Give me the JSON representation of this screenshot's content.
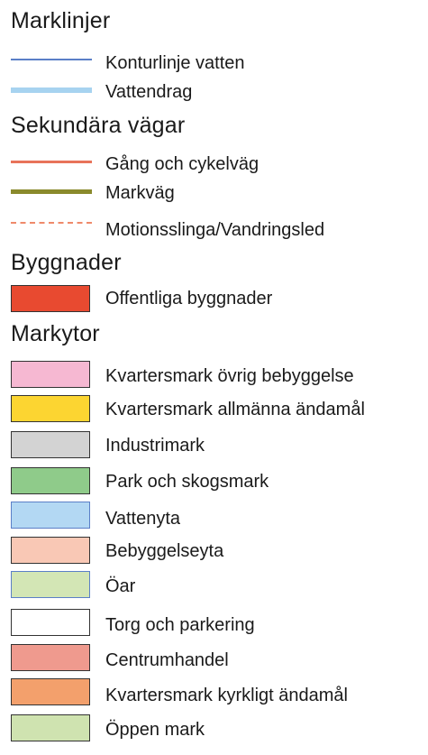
{
  "legend": {
    "marklinjer": {
      "heading": "Marklinjer",
      "items": [
        {
          "label": "Konturlinje vatten",
          "color": "#5b7fc7",
          "style": "line-thin"
        },
        {
          "label": "Vattendrag",
          "color": "#a7d3f0",
          "style": "line-thick"
        }
      ]
    },
    "sekundara_vagar": {
      "heading": "Sekundära vägar",
      "items": [
        {
          "label": "Gång och cykelväg",
          "color": "#e8735a",
          "style": "line"
        },
        {
          "label": "Markväg",
          "color": "#8a8a2c",
          "style": "line-thick"
        },
        {
          "label": "Motionsslinga/Vandringsled",
          "color": "#ef8a6a",
          "style": "dashed"
        }
      ]
    },
    "byggnader": {
      "heading": "Byggnader",
      "items": [
        {
          "label": "Offentliga byggnader",
          "color": "#e84a30",
          "style": "fill"
        }
      ]
    },
    "markytor": {
      "heading": "Markytor",
      "items": [
        {
          "label": "Kvartersmark övrig bebyggelse",
          "color": "#f6b8d2",
          "style": "fill"
        },
        {
          "label": "Kvartersmark allmänna ändamål",
          "color": "#fcd531",
          "style": "fill"
        },
        {
          "label": "Industrimark",
          "color": "#d3d3d3",
          "style": "fill"
        },
        {
          "label": "Park och skogsmark",
          "color": "#8fcb8a",
          "style": "fill"
        },
        {
          "label": "Vattenyta",
          "color": "#b3d8f3",
          "style": "fill"
        },
        {
          "label": "Bebyggelseyta",
          "color": "#f9c8b5",
          "style": "fill"
        },
        {
          "label": "Öar",
          "color": "#d3e6b5",
          "style": "fill"
        },
        {
          "label": "Torg och parkering",
          "color": "#ffffff",
          "style": "fill"
        },
        {
          "label": "Centrumhandel",
          "color": "#ef9a8e",
          "style": "fill"
        },
        {
          "label": "Kvartersmark kyrkligt ändamål",
          "color": "#f3a06c",
          "style": "fill"
        },
        {
          "label": "Öppen mark",
          "color": "#cfe3b0",
          "style": "fill"
        }
      ]
    }
  }
}
